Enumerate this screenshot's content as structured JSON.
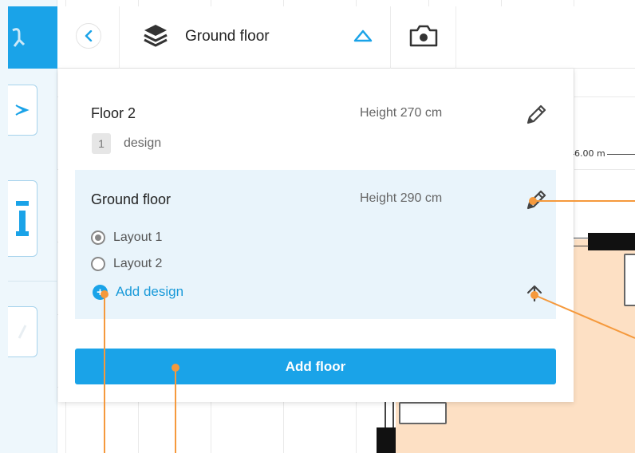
{
  "top_bar": {
    "floor_title": "Ground floor"
  },
  "canvas": {
    "dimension_label": "6.00 m"
  },
  "panel": {
    "floors": [
      {
        "name": "Floor 2",
        "height": "Height 270 cm",
        "design_count": "1",
        "design_label": "design"
      },
      {
        "name": "Ground floor",
        "height": "Height 290 cm",
        "layouts": [
          "Layout 1",
          "Layout 2"
        ],
        "selected_layout": "Layout 1",
        "add_design_label": "Add design"
      }
    ],
    "add_floor_label": "Add floor"
  },
  "icons": {
    "back": "chevron-left-icon",
    "layers": "layers-icon",
    "collapse": "triangle-up-icon",
    "camera": "camera-icon",
    "edit": "pencil-icon",
    "move_up": "arrow-up-icon",
    "add": "plus-circle-icon"
  },
  "colors": {
    "accent": "#1aa3e8",
    "selected_bg": "#e9f4fb",
    "callout": "#f5993c",
    "floor_fill": "#fde0c4"
  }
}
